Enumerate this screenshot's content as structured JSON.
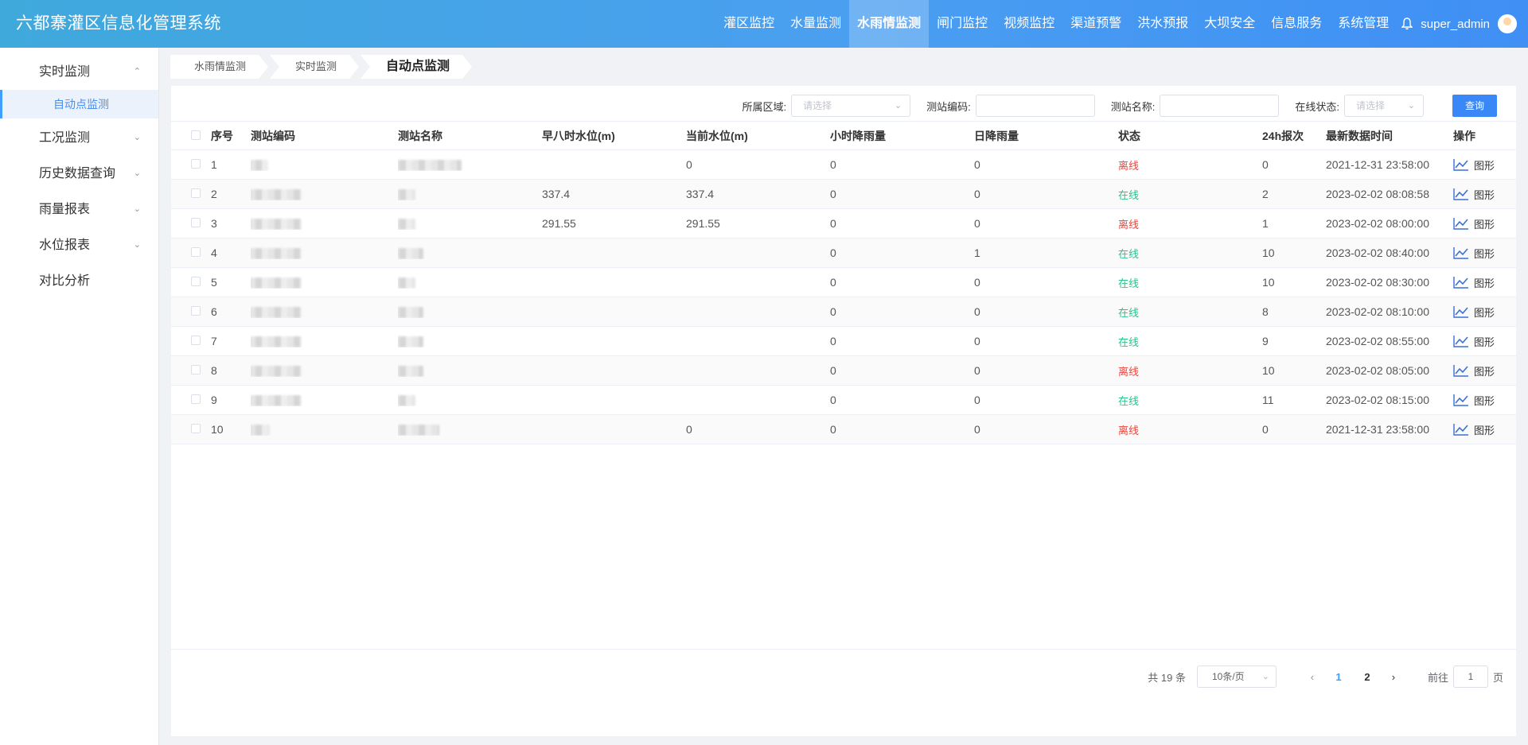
{
  "header": {
    "title": "六都寨灌区信息化管理系统",
    "nav": [
      "灌区监控",
      "水量监测",
      "水雨情监测",
      "闸门监控",
      "视频监控",
      "渠道预警",
      "洪水预报",
      "大坝安全",
      "信息服务",
      "系统管理"
    ],
    "active_nav": "水雨情监测",
    "user": "super_admin"
  },
  "sidebar": {
    "items": [
      {
        "label": "实时监测",
        "icon": "chevron-up-icon",
        "expanded": true
      },
      {
        "label": "工况监测",
        "icon": "chevron-down-icon"
      },
      {
        "label": "历史数据查询",
        "icon": "chevron-down-icon"
      },
      {
        "label": "雨量报表",
        "icon": "chevron-down-icon"
      },
      {
        "label": "水位报表",
        "icon": "chevron-down-icon"
      },
      {
        "label": "对比分析",
        "icon": ""
      }
    ],
    "subitem": "自动点监测"
  },
  "breadcrumb": [
    "水雨情监测",
    "实时监测",
    "自动点监测"
  ],
  "filters": {
    "region_label": "所属区域:",
    "region_placeholder": "请选择",
    "code_label": "测站编码:",
    "name_label": "测站名称:",
    "status_label": "在线状态:",
    "status_placeholder": "请选择",
    "query_button": "查询"
  },
  "table": {
    "headers": {
      "seq": "序号",
      "code": "测站编码",
      "name": "测站名称",
      "am8": "早八时水位(m)",
      "current": "当前水位(m)",
      "hour_rain": "小时降雨量",
      "day_rain": "日降雨量",
      "status": "状态",
      "reports": "24h报次",
      "latest_time": "最新数据时间",
      "op": "操作"
    },
    "rows": [
      {
        "seq": "1",
        "am8": "",
        "current": "0",
        "hour_rain": "0",
        "day_rain": "0",
        "status": "离线",
        "online": false,
        "reports": "0",
        "time": "2021-12-31 23:58:00",
        "op": "图形"
      },
      {
        "seq": "2",
        "am8": "337.4",
        "current": "337.4",
        "hour_rain": "0",
        "day_rain": "0",
        "status": "在线",
        "online": true,
        "reports": "2",
        "time": "2023-02-02 08:08:58",
        "op": "图形"
      },
      {
        "seq": "3",
        "am8": "291.55",
        "current": "291.55",
        "hour_rain": "0",
        "day_rain": "0",
        "status": "离线",
        "online": false,
        "reports": "1",
        "time": "2023-02-02 08:00:00",
        "op": "图形"
      },
      {
        "seq": "4",
        "am8": "",
        "current": "",
        "hour_rain": "0",
        "day_rain": "1",
        "status": "在线",
        "online": true,
        "reports": "10",
        "time": "2023-02-02 08:40:00",
        "op": "图形"
      },
      {
        "seq": "5",
        "am8": "",
        "current": "",
        "hour_rain": "0",
        "day_rain": "0",
        "status": "在线",
        "online": true,
        "reports": "10",
        "time": "2023-02-02 08:30:00",
        "op": "图形"
      },
      {
        "seq": "6",
        "am8": "",
        "current": "",
        "hour_rain": "0",
        "day_rain": "0",
        "status": "在线",
        "online": true,
        "reports": "8",
        "time": "2023-02-02 08:10:00",
        "op": "图形"
      },
      {
        "seq": "7",
        "am8": "",
        "current": "",
        "hour_rain": "0",
        "day_rain": "0",
        "status": "在线",
        "online": true,
        "reports": "9",
        "time": "2023-02-02 08:55:00",
        "op": "图形"
      },
      {
        "seq": "8",
        "am8": "",
        "current": "",
        "hour_rain": "0",
        "day_rain": "0",
        "status": "离线",
        "online": false,
        "reports": "10",
        "time": "2023-02-02 08:05:00",
        "op": "图形"
      },
      {
        "seq": "9",
        "am8": "",
        "current": "",
        "hour_rain": "0",
        "day_rain": "0",
        "status": "在线",
        "online": true,
        "reports": "11",
        "time": "2023-02-02 08:15:00",
        "op": "图形"
      },
      {
        "seq": "10",
        "am8": "",
        "current": "0",
        "hour_rain": "0",
        "day_rain": "0",
        "status": "离线",
        "online": false,
        "reports": "0",
        "time": "2021-12-31 23:58:00",
        "op": "图形"
      }
    ]
  },
  "pagination": {
    "total": "共 19 条",
    "page_size": "10条/页",
    "pages": [
      "1",
      "2"
    ],
    "current_page": "1",
    "goto_prefix": "前往",
    "goto_value": "1",
    "goto_suffix": "页"
  },
  "colors": {
    "header_start": "#3fa9dc",
    "header_end": "#3f8ff5",
    "accent": "#409eff",
    "online": "#2bc28a",
    "offline": "#f0443b"
  }
}
